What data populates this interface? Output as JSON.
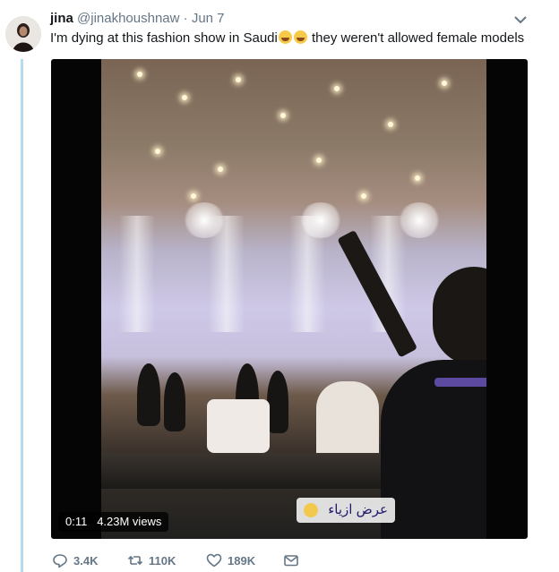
{
  "tweet": {
    "author_name": "jina",
    "author_handle": "@jinakhoushnaw",
    "separator": "·",
    "date": "Jun 7",
    "text_part1": "I'm dying at this fashion show in Saudi",
    "text_part2": " they weren't allowed female models",
    "emoji_name": "laughing-tears-icon"
  },
  "media": {
    "caption_text": "عرض ازياء",
    "time": "0:11",
    "views": "4.23M views"
  },
  "actions": {
    "reply_count": "3.4K",
    "retweet_count": "110K",
    "like_count": "189K"
  },
  "colors": {
    "thread_line": "#b3dcf2",
    "muted_text": "#657786"
  }
}
